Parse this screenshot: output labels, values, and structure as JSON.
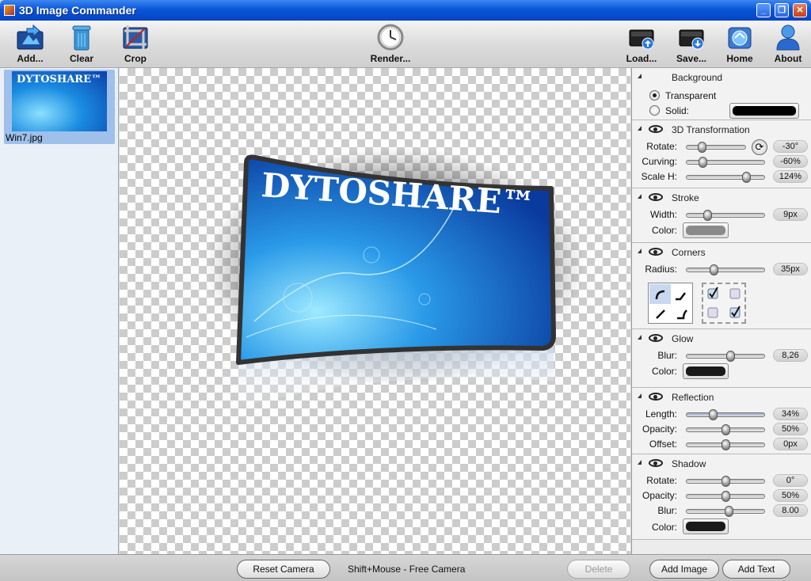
{
  "window": {
    "title": "3D Image Commander"
  },
  "toolbar": {
    "add": "Add...",
    "clear": "Clear",
    "crop": "Crop",
    "render": "Render...",
    "load": "Load...",
    "save": "Save...",
    "home": "Home",
    "about": "About"
  },
  "image_list": [
    {
      "name": "Win7.jpg",
      "thumb_text": "DYTOSHARE™"
    }
  ],
  "canvas": {
    "image_text": "DYTOSHARE™"
  },
  "panel": {
    "background": {
      "title": "Background",
      "transparent_label": "Transparent",
      "solid_label": "Solid:",
      "selected": "Transparent",
      "solid_color": "#000000"
    },
    "transform": {
      "title": "3D Transformation",
      "rotate_label": "Rotate:",
      "rotate_value": "-30°",
      "rotate_level": 0.25,
      "curving_label": "Curving:",
      "curving_value": "-60%",
      "curving_level": 0.2,
      "scaleh_label": "Scale H:",
      "scaleh_value": "124%",
      "scaleh_level": 0.77
    },
    "stroke": {
      "title": "Stroke",
      "width_label": "Width:",
      "width_value": "9px",
      "width_level": 0.27,
      "color_label": "Color:",
      "color": "#8a8a8a"
    },
    "corners": {
      "title": "Corners",
      "radius_label": "Radius:",
      "radius_value": "35px",
      "radius_level": 0.35
    },
    "glow": {
      "title": "Glow",
      "blur_label": "Blur:",
      "blur_value": "8,26",
      "blur_level": 0.56,
      "color_label": "Color:",
      "color": "#1a1a1a"
    },
    "reflection": {
      "title": "Reflection",
      "length_label": "Length:",
      "length_value": "34%",
      "length_level": 0.34,
      "opacity_label": "Opacity:",
      "opacity_value": "50%",
      "opacity_level": 0.5,
      "offset_label": "Offset:",
      "offset_value": "0px",
      "offset_level": 0.5
    },
    "shadow": {
      "title": "Shadow",
      "rotate_label": "Rotate:",
      "rotate_value": "0°",
      "rotate_level": 0.5,
      "opacity_label": "Opacity:",
      "opacity_value": "50%",
      "opacity_level": 0.5,
      "blur_label": "Blur:",
      "blur_value": "8.00",
      "blur_level": 0.54,
      "color_label": "Color:",
      "color": "#1a1a1a"
    }
  },
  "status": {
    "reset_camera": "Reset Camera",
    "hint": "Shift+Mouse - Free Camera",
    "delete": "Delete",
    "add_image": "Add Image",
    "add_text": "Add Text"
  }
}
